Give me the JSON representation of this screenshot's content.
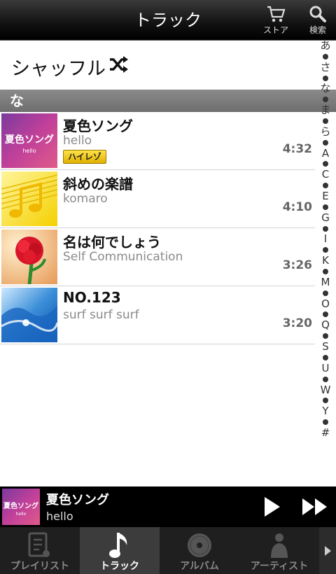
{
  "header": {
    "title": "トラック",
    "store_label": "ストア",
    "search_label": "検索"
  },
  "shuffle": {
    "label": "シャッフル"
  },
  "section": {
    "label": "な"
  },
  "tracks": [
    {
      "title": "夏色ソング",
      "artist": "hello",
      "duration": "4:32",
      "badge": "ハイレゾ",
      "art_text": "夏色ソング",
      "art_sub": "hello"
    },
    {
      "title": "斜めの楽譜",
      "artist": "komaro",
      "duration": "4:10"
    },
    {
      "title": "名は何でしょう",
      "artist": "Self Communication",
      "duration": "3:26"
    },
    {
      "title": "NO.123",
      "artist": "surf surf surf",
      "duration": "3:20"
    }
  ],
  "index": [
    "あ",
    "•",
    "さ",
    "•",
    "な",
    "•",
    "ま",
    "•",
    "ら",
    "•",
    "A",
    "•",
    "C",
    "•",
    "E",
    "•",
    "G",
    "•",
    "I",
    "•",
    "K",
    "•",
    "M",
    "•",
    "O",
    "•",
    "Q",
    "•",
    "S",
    "•",
    "U",
    "•",
    "W",
    "•",
    "Y",
    "•",
    "#"
  ],
  "now_playing": {
    "title": "夏色ソング",
    "artist": "hello",
    "art_text": "夏色ソング",
    "art_sub": "hello"
  },
  "tabs": [
    {
      "label": "プレイリスト",
      "active": false
    },
    {
      "label": "トラック",
      "active": true
    },
    {
      "label": "アルバム",
      "active": false
    },
    {
      "label": "アーティスト",
      "active": false
    }
  ],
  "colors": {
    "badge": "#f5c800",
    "section_bg": "#777777",
    "active_tab": "#3c3c3c"
  }
}
